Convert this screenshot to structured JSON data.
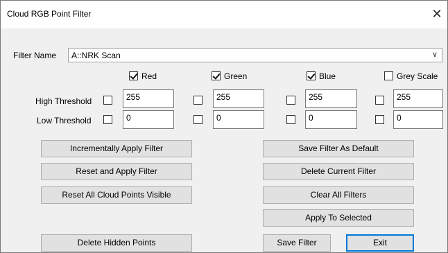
{
  "window": {
    "title": "Cloud RGB Point Filter"
  },
  "filter": {
    "label": "Filter Name",
    "value": "A::NRK Scan"
  },
  "channels": [
    {
      "label": "Red",
      "checked": true,
      "high": "255",
      "low": "0"
    },
    {
      "label": "Green",
      "checked": true,
      "high": "255",
      "low": "0"
    },
    {
      "label": "Blue",
      "checked": true,
      "high": "255",
      "low": "0"
    },
    {
      "label": "Grey Scale",
      "checked": false,
      "high": "255",
      "low": "0"
    }
  ],
  "rows": {
    "high_label": "High Threshold",
    "low_label": "Low Threshold"
  },
  "buttons": {
    "incremental": "Incrementally Apply Filter",
    "reset_apply": "Reset and Apply Filter",
    "reset_visible": "Reset All Cloud Points Visible",
    "delete_hidden": "Delete Hidden Points",
    "save_default": "Save Filter As Default",
    "delete_current": "Delete Current Filter",
    "clear_all": "Clear All Filters",
    "apply_selected": "Apply To Selected",
    "save_filter": "Save Filter",
    "exit": "Exit"
  }
}
